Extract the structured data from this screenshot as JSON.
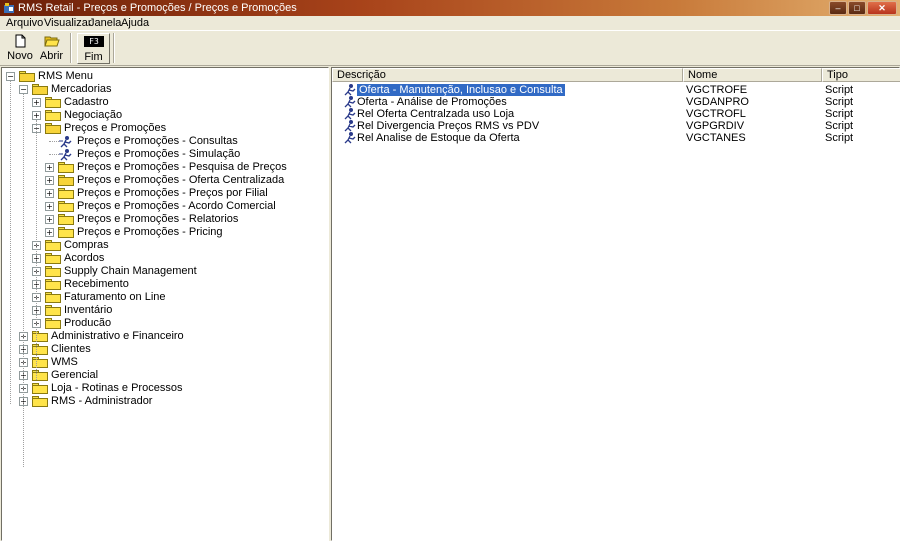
{
  "window": {
    "title": "RMS Retail - Preços e Promoções / Preços e Promoções",
    "controls": {
      "minimize": "–",
      "maximize": "□",
      "close": "✕"
    }
  },
  "menubar": {
    "items": [
      "Arquivo",
      "Visualizar",
      "Janela",
      "Ajuda"
    ]
  },
  "toolbar": {
    "novo_label": "Novo",
    "abrir_label": "Abrir",
    "fim_label": "Fim",
    "fim_key": "F3"
  },
  "tree": {
    "root": "RMS Menu",
    "mercadorias": "Mercadorias",
    "cadastro": "Cadastro",
    "negociacao": "Negociação",
    "precos": "Preços e Promoções",
    "precos_children": [
      "Preços e Promoções - Consultas",
      "Preços e Promoções - Simulação",
      "Preços e Promoções - Pesquisa de Preços",
      "Preços e Promoções - Oferta Centralizada",
      "Preços e Promoções - Preços por Filial",
      "Preços e Promoções - Acordo Comercial",
      "Preços e Promoções - Relatorios",
      "Preços e Promoções - Pricing"
    ],
    "mercadorias_rest": [
      "Compras",
      "Acordos",
      "Supply Chain Management",
      "Recebimento",
      "Faturamento on Line",
      "Inventário",
      "Producão"
    ],
    "top_rest": [
      "Administrativo e Financeiro",
      "Clientes",
      "WMS",
      "Gerencial",
      "Loja - Rotinas e Processos",
      "RMS - Administrador"
    ],
    "expander_plus": "+",
    "expander_minus": "−"
  },
  "list": {
    "columns": [
      "Descrição",
      "Nome",
      "Tipo"
    ],
    "rows": [
      {
        "desc": "Oferta - Manutenção, Inclusao e Consulta",
        "nome": "VGCTROFE",
        "tipo": "Script",
        "selected": true
      },
      {
        "desc": "Oferta - Análise de Promoções",
        "nome": "VGDANPRO",
        "tipo": "Script"
      },
      {
        "desc": "Rel Oferta Centralzada uso Loja",
        "nome": "VGCTROFL",
        "tipo": "Script"
      },
      {
        "desc": "Rel Divergencia Preços RMS vs PDV",
        "nome": "VGPGRDIV",
        "tipo": "Script"
      },
      {
        "desc": "Rel Analise de Estoque da Oferta",
        "nome": "VGCTANES",
        "tipo": "Script"
      }
    ]
  },
  "colors": {
    "selection": "#316ac5",
    "folder": "#ffe44a",
    "titlebar": "#a8431a"
  }
}
